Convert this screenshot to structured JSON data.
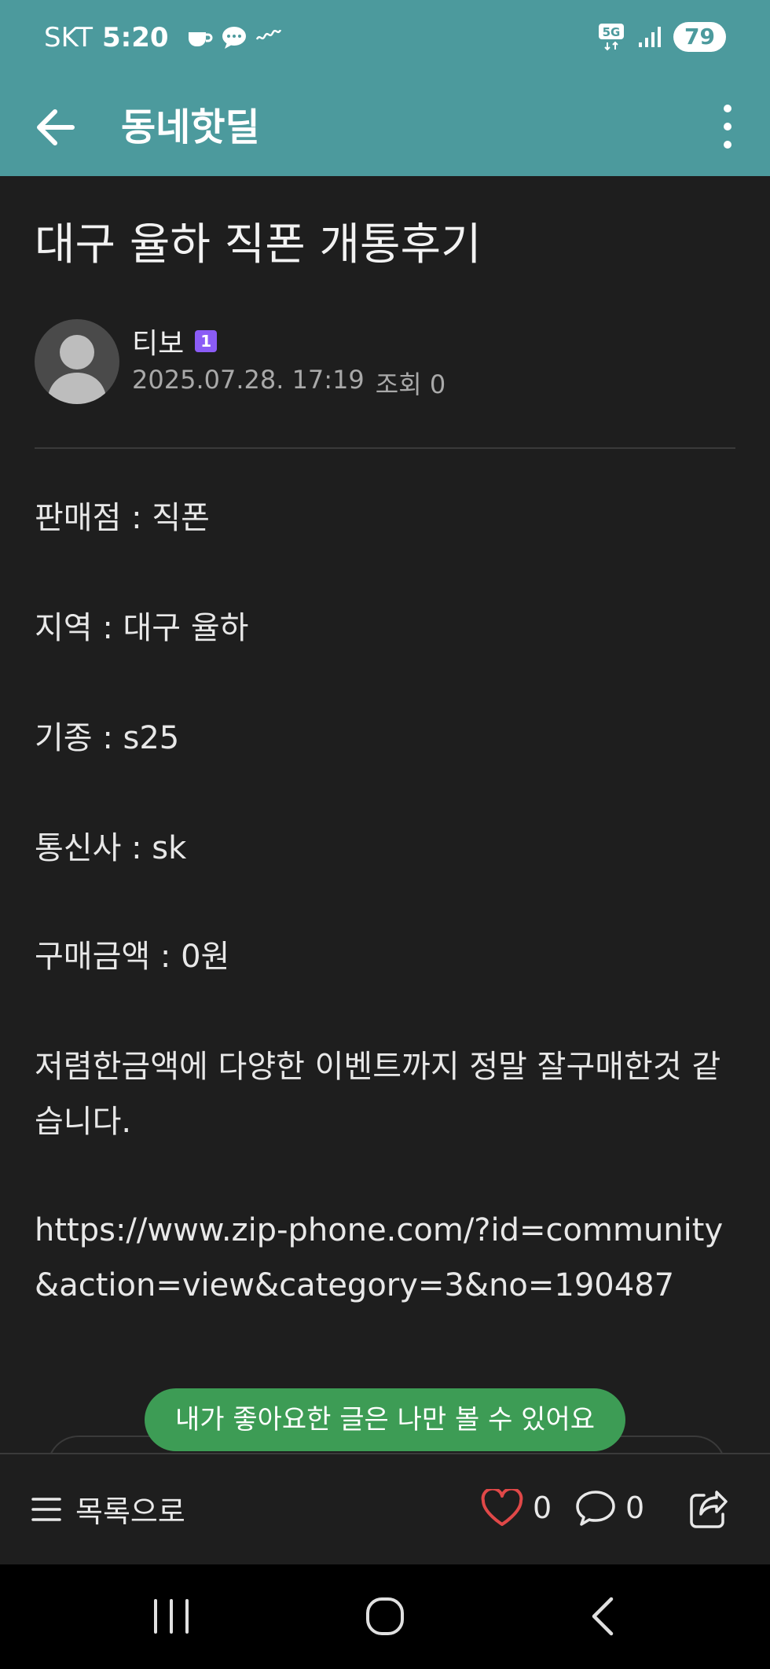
{
  "status_bar": {
    "carrier": "SKT",
    "time": "5:20",
    "network": "5G",
    "battery": "79"
  },
  "app_bar": {
    "title": "동네핫딜"
  },
  "post": {
    "title": "대구 율하 직폰 개통후기",
    "author": "티보",
    "level": "1",
    "date": "2025.07.28. 17:19",
    "views_label": "조회 0",
    "lines": [
      "판매점 : 직폰",
      "지역 :  대구 율하",
      "기종 : s25",
      "통신사 : sk",
      "구매금액 : 0원"
    ],
    "paragraph": "저렴한금액에 다양한 이벤트까지 정말 잘구매한것 같습니다.",
    "link": "https://www.zip-phone.com/?id=community&action=view&category=3&no=190487"
  },
  "toast": "내가 좋아요한 글은 나만 볼 수 있어요",
  "bottom_bar": {
    "list_label": "목록으로",
    "like_count": "0",
    "comment_count": "0"
  },
  "colors": {
    "header": "#4c9a9d",
    "background": "#1e1e1e",
    "toast": "#3d9c55",
    "like_icon": "#e04848"
  },
  "icons": {
    "back": "arrow-left-icon",
    "more": "more-vertical-icon",
    "list": "menu-icon",
    "like": "heart-icon",
    "comment": "speech-bubble-icon",
    "share": "share-icon"
  }
}
